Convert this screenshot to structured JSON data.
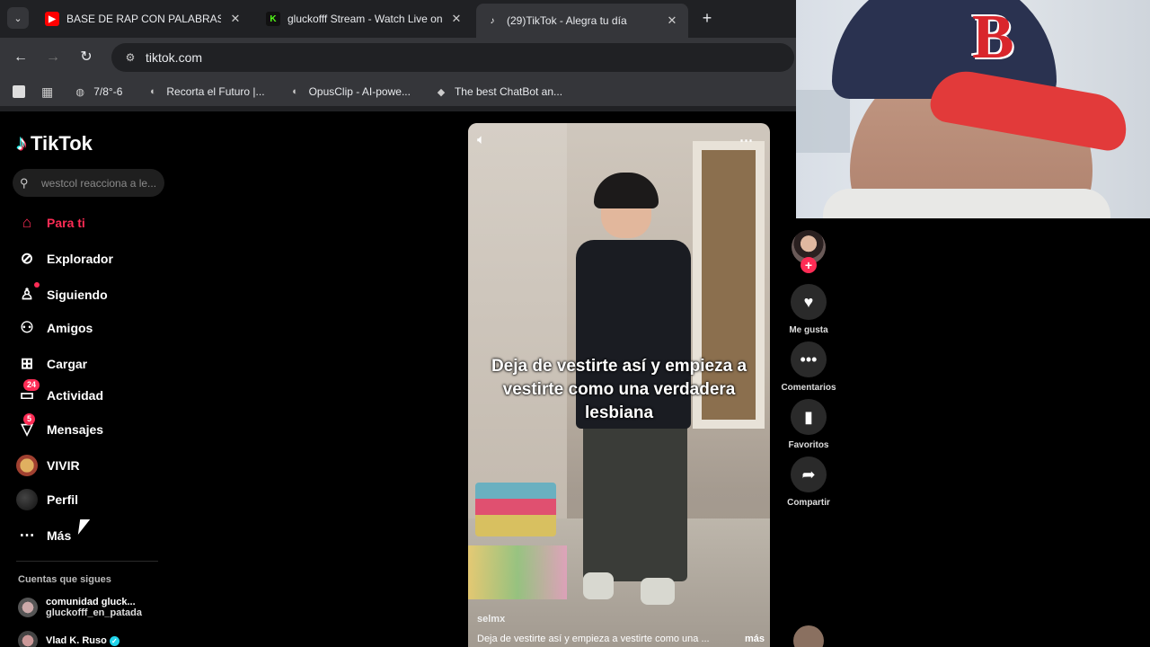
{
  "browser": {
    "tabs": [
      {
        "title": "BASE DE RAP CON PALABRAS🔥",
        "favicon": "youtube-icon",
        "active": false
      },
      {
        "title": "gluckofff Stream - Watch Live on Kick",
        "favicon": "kick-icon",
        "active": false
      },
      {
        "title": "(29)TikTok - Alegra tu día",
        "favicon": "tiktok-icon",
        "active": true
      }
    ],
    "url": "tiktok.com",
    "bookmarks": [
      {
        "label": "7/8°-6",
        "icon": "globe-icon"
      },
      {
        "label": "Recorta el Futuro |...",
        "icon": "opus-icon"
      },
      {
        "label": "OpusClip - AI-powe...",
        "icon": "opus-icon"
      },
      {
        "label": "The best ChatBot an...",
        "icon": "chatbot-icon"
      }
    ]
  },
  "tiktok": {
    "logo_text": "TikTok",
    "search_placeholder": "westcol reacciona a le...",
    "nav": [
      {
        "label": "Para ti",
        "icon": "home-icon",
        "active": true
      },
      {
        "label": "Explorador",
        "icon": "compass-icon"
      },
      {
        "label": "Siguiendo",
        "icon": "following-icon"
      },
      {
        "label": "Amigos",
        "icon": "friends-icon"
      },
      {
        "label": "Cargar",
        "icon": "upload-icon"
      },
      {
        "label": "Actividad",
        "icon": "inbox-icon",
        "badge": "24"
      },
      {
        "label": "Mensajes",
        "icon": "send-icon",
        "badge": "5"
      },
      {
        "label": "VIVIR",
        "icon": "live-avatar-icon"
      },
      {
        "label": "Perfil",
        "icon": "profile-avatar-icon"
      },
      {
        "label": "Más",
        "icon": "more-icon"
      }
    ],
    "following_title": "Cuentas que sigues",
    "following": [
      {
        "name": "comunidad gluck...",
        "handle": "gluckofff_en_patada"
      },
      {
        "name": "Vlad K. Ruso",
        "verified": true
      }
    ]
  },
  "video": {
    "caption": "Deja de vestirte así y empieza a vestirte como una verdadera lesbiana",
    "author": "selmx",
    "description": "Deja de vestirte así y empieza a vestirte como una ...",
    "more_label": "más"
  },
  "actions": [
    {
      "label": "Me gusta",
      "icon": "heart-icon"
    },
    {
      "label": "Comentarios",
      "icon": "comment-icon"
    },
    {
      "label": "Favoritos",
      "icon": "bookmark-icon"
    },
    {
      "label": "Compartir",
      "icon": "share-icon"
    }
  ],
  "colors": {
    "accent": "#fe2c55",
    "chrome_bg": "#202124",
    "toolbar_bg": "#35363a"
  }
}
